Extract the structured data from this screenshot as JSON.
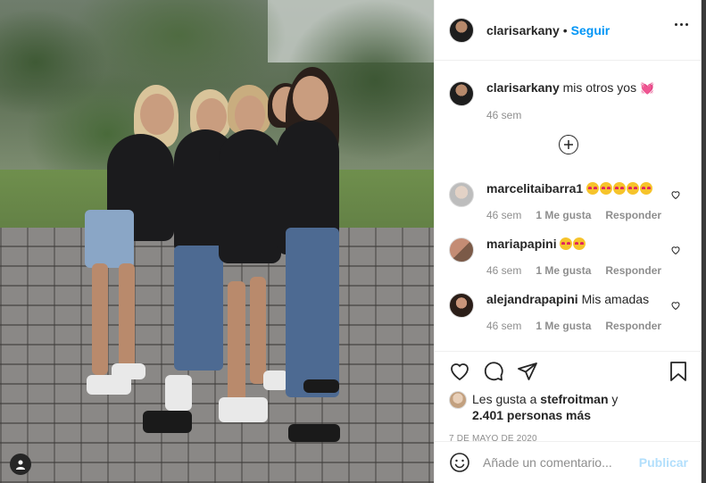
{
  "post": {
    "username": "clarisarkany",
    "follow_label": "Seguir",
    "caption_user": "clarisarkany",
    "caption_text": "mis otros yos",
    "caption_emoji": "heart-icon",
    "caption_time": "46 sem"
  },
  "comments": [
    {
      "user": "marcelitaibarra1",
      "text": "",
      "emoji_count": 5,
      "time": "46 sem",
      "likes": "1 Me gusta",
      "reply": "Responder"
    },
    {
      "user": "mariapapini",
      "text": "",
      "emoji_count": 2,
      "time": "46 sem",
      "likes": "1 Me gusta",
      "reply": "Responder"
    },
    {
      "user": "alejandrapapini",
      "text": "Mis amadas",
      "emoji_count": 0,
      "time": "46 sem",
      "likes": "1 Me gusta",
      "reply": "Responder"
    }
  ],
  "likes": {
    "prefix": "Les gusta a",
    "user": "stefroitman",
    "joiner": "y",
    "others": "2.401 personas más"
  },
  "date": "7 DE MAYO DE 2020",
  "add_comment": {
    "placeholder": "Añade un comentario...",
    "publish": "Publicar"
  },
  "colors": {
    "link_blue": "#0095f6",
    "publish_disabled": "#b2dffc",
    "muted": "#8e8e8e"
  }
}
